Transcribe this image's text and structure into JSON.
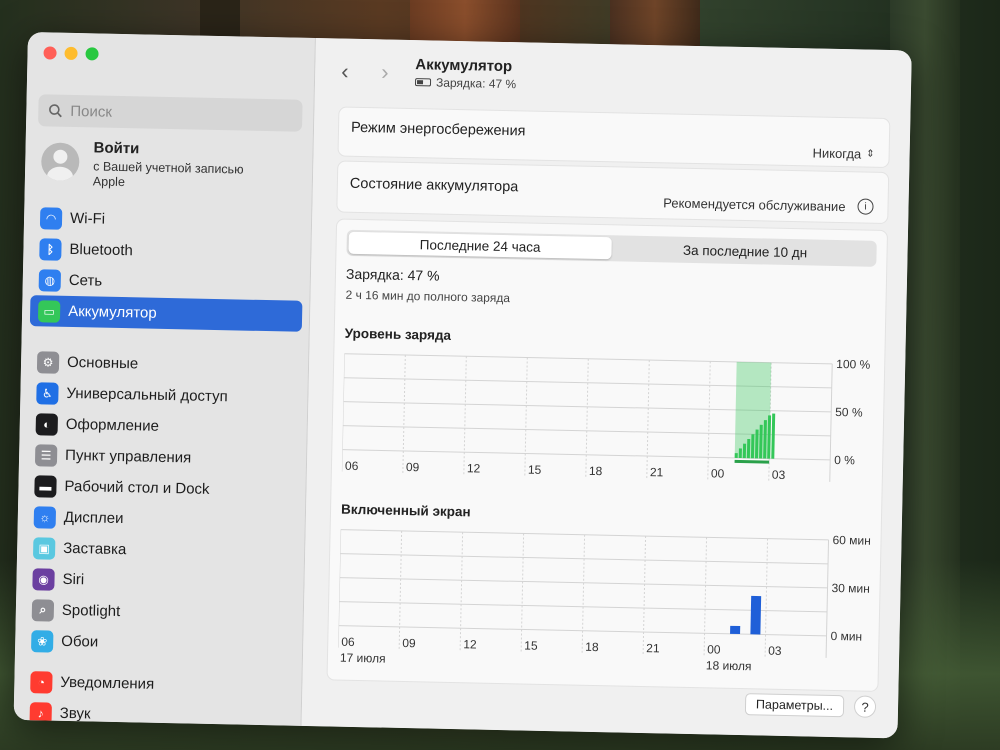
{
  "sidebar": {
    "search_placeholder": "Поиск",
    "account": {
      "title": "Войти",
      "subtitle": "с Вашей учетной записью Apple"
    },
    "items": [
      {
        "label": "Wi-Fi",
        "icon": "wifi-icon",
        "color": "#2f7ff0"
      },
      {
        "label": "Bluetooth",
        "icon": "bluetooth-icon",
        "color": "#2f7ff0"
      },
      {
        "label": "Сеть",
        "icon": "globe-icon",
        "color": "#2f7ff0"
      },
      {
        "label": "Аккумулятор",
        "icon": "battery-icon",
        "color": "#34c759"
      },
      {
        "label": "Основные",
        "icon": "gear-icon",
        "color": "#8e8e93"
      },
      {
        "label": "Универсальный доступ",
        "icon": "accessibility-icon",
        "color": "#1f6fe5"
      },
      {
        "label": "Оформление",
        "icon": "appearance-icon",
        "color": "#1c1c1e"
      },
      {
        "label": "Пункт управления",
        "icon": "control-center-icon",
        "color": "#8e8e93"
      },
      {
        "label": "Рабочий стол и Dock",
        "icon": "dock-icon",
        "color": "#1c1c1e"
      },
      {
        "label": "Дисплеи",
        "icon": "display-icon",
        "color": "#2f7ff0"
      },
      {
        "label": "Заставка",
        "icon": "screensaver-icon",
        "color": "#5ac8e0"
      },
      {
        "label": "Siri",
        "icon": "siri-icon",
        "color": "#6b3fa0"
      },
      {
        "label": "Spotlight",
        "icon": "spotlight-icon",
        "color": "#8e8e93"
      },
      {
        "label": "Обои",
        "icon": "wallpaper-icon",
        "color": "#32ade6"
      },
      {
        "label": "Уведомления",
        "icon": "notifications-icon",
        "color": "#ff3b30"
      },
      {
        "label": "Звук",
        "icon": "sound-icon",
        "color": "#ff3b30"
      }
    ]
  },
  "header": {
    "title": "Аккумулятор",
    "subtitle": "Зарядка: 47 %"
  },
  "low_power": {
    "label": "Режим энергосбережения",
    "value": "Никогда"
  },
  "battery_health": {
    "label": "Состояние аккумулятора",
    "value": "Рекомендуется обслуживание"
  },
  "usage": {
    "tabs": [
      "Последние 24 часа",
      "За последние 10 дн"
    ],
    "charge": "Зарядка: 47 %",
    "time_to_full": "2 ч 16 мин до полного заряда"
  },
  "chart_data": [
    {
      "type": "bar",
      "title": "Уровень заряда",
      "x_ticks": [
        "06",
        "09",
        "12",
        "15",
        "18",
        "21",
        "00",
        "03"
      ],
      "y_ticks": [
        "100 %",
        "50 %",
        "0 %"
      ],
      "ylim": [
        0,
        100
      ],
      "series": [
        {
          "values": [
            5,
            10,
            15,
            20,
            25,
            30,
            35,
            40,
            45,
            47
          ],
          "x_start_hour": 1.3,
          "x_step_hour": 0.2
        }
      ],
      "charging_band_hours": [
        1.3,
        3.0
      ],
      "color": "#34c759"
    },
    {
      "type": "bar",
      "title": "Включенный экран",
      "x_ticks": [
        "06",
        "09",
        "12",
        "15",
        "18",
        "21",
        "00",
        "03"
      ],
      "date_labels": [
        "17 июля",
        "18 июля"
      ],
      "y_ticks": [
        "60 мин",
        "30 мин",
        "0 мин"
      ],
      "ylim": [
        0,
        60
      ],
      "series": [
        {
          "values": [
            5,
            24
          ],
          "x_hours": [
            1.5,
            2.5
          ]
        }
      ],
      "color": "#1f5fd8"
    }
  ],
  "footer": {
    "params_label": "Параметры...",
    "help_label": "?"
  }
}
